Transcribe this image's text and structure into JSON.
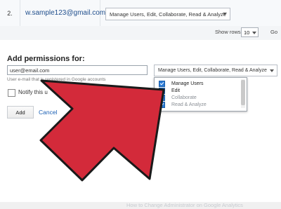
{
  "account_row": {
    "index": "2.",
    "email": "w.sample123@gmail.com",
    "permission": "Manage Users, Edit, Collaborate, Read & Analyze"
  },
  "pagination": {
    "show_rows_label": "Show rows:",
    "rows_value": "10",
    "go_label": "Go"
  },
  "add_permissions": {
    "heading": "Add permissions for:",
    "email_value": "user@email.com",
    "hint": "User e-mail that is registered in Google accounts",
    "permission_select": "Manage Users, Edit, Collaborate, Read & Analyze",
    "notify_label": "Notify this u",
    "add_label": "Add",
    "cancel_label": "Cancel"
  },
  "dropdown": {
    "options": [
      {
        "label": "Manage Users",
        "checked": true,
        "enabled": true
      },
      {
        "label": "Edit",
        "checked": true,
        "enabled": true
      },
      {
        "label": "Collaborate",
        "checked": true,
        "enabled": false
      },
      {
        "label": "Read & Analyze",
        "checked": true,
        "enabled": false
      }
    ]
  },
  "banner": {
    "text": "How to Change Administrator on Google Analytics"
  },
  "colors": {
    "arrow": "#d32a3a",
    "checkbox": "#2b7bd6",
    "link": "#1a5fb4"
  }
}
